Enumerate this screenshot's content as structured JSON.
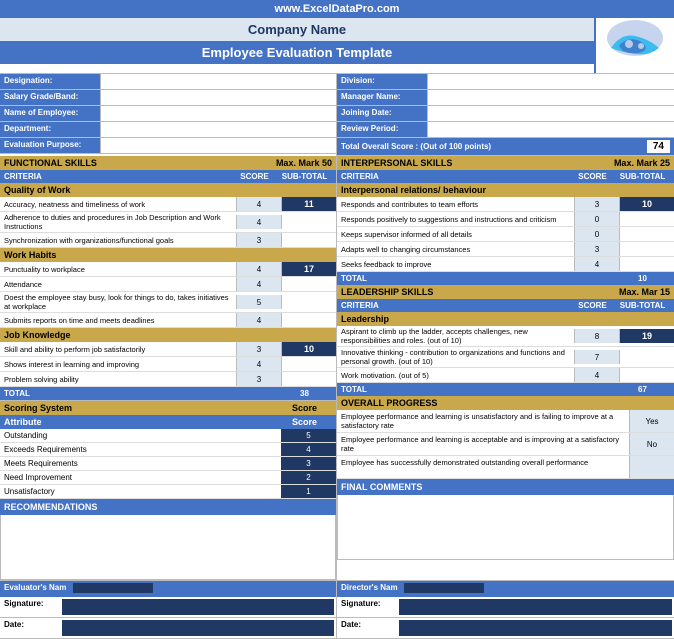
{
  "site": {
    "url": "www.ExcelDataPro.com",
    "company": "Company Name",
    "title": "Employee Evaluation Template"
  },
  "header": {
    "left": [
      {
        "label": "Designation:",
        "value": ""
      },
      {
        "label": "Salary Grade/Band:",
        "value": ""
      },
      {
        "label": "Name of Employee:",
        "value": ""
      },
      {
        "label": "Department:",
        "value": ""
      },
      {
        "label": "Evaluation Purpose:",
        "value": ""
      }
    ],
    "right": [
      {
        "label": "Division:",
        "value": ""
      },
      {
        "label": "Manager Name:",
        "value": ""
      },
      {
        "label": "Joining Date:",
        "value": ""
      },
      {
        "label": "Review Period:",
        "value": ""
      },
      {
        "label": "Total Overall Score : (Out of 100 points)",
        "value": "74"
      }
    ]
  },
  "functional_skills": {
    "title": "FUNCTIONAL SKILLS",
    "max_label": "Max. Mark",
    "max_value": "50",
    "criteria_label": "CRITERIA",
    "score_label": "SCORE",
    "subtotal_label": "SUB-TOTAL",
    "total_label": "TOTAL",
    "total_value": "38",
    "sections": [
      {
        "name": "Quality of Work",
        "subtotal": "11",
        "items": [
          {
            "text": "Accuracy, neatness and timeliness of work",
            "score": "4",
            "subtotal": ""
          },
          {
            "text": "Adherence to duties and procedures in Job Description and Work Instructions",
            "score": "4",
            "subtotal": ""
          },
          {
            "text": "Synchronization with organizations/functional goals",
            "score": "3",
            "subtotal": ""
          }
        ]
      },
      {
        "name": "Work Habits",
        "subtotal": "17",
        "items": [
          {
            "text": "Punctuality to workplace",
            "score": "4",
            "subtotal": ""
          },
          {
            "text": "Attendance",
            "score": "4",
            "subtotal": ""
          },
          {
            "text": "Doest the employee stay busy, look for things to do, takes initiatives at workplace",
            "score": "5",
            "subtotal": ""
          },
          {
            "text": "Submits reports on time and meets deadlines",
            "score": "4",
            "subtotal": ""
          }
        ]
      },
      {
        "name": "Job Knowledge",
        "subtotal": "10",
        "items": [
          {
            "text": "Skill and ability to perform job satisfactorily",
            "score": "3",
            "subtotal": ""
          },
          {
            "text": "Shows interest in learning and improving",
            "score": "4",
            "subtotal": ""
          },
          {
            "text": "Problem solving ability",
            "score": "3",
            "subtotal": ""
          }
        ]
      }
    ]
  },
  "scoring_system": {
    "title": "Scoring System",
    "attr_label": "Attribute",
    "score_label": "Score",
    "items": [
      {
        "label": "Outstanding",
        "value": "5"
      },
      {
        "label": "Exceeds Requirements",
        "value": "4"
      },
      {
        "label": "Meets Requirements",
        "value": "3"
      },
      {
        "label": "Need Improvement",
        "value": "2"
      },
      {
        "label": "Unsatisfactory",
        "value": "1"
      }
    ]
  },
  "recommendations": {
    "title": "RECOMMENDATIONS"
  },
  "interpersonal_skills": {
    "title": "INTERPERSONAL SKILLS",
    "max_label": "Max. Mark",
    "max_value": "25",
    "criteria_label": "CRITERIA",
    "score_label": "SCORE",
    "subtotal_label": "SUB-TOTAL",
    "sections": [
      {
        "name": "Interpersonal relations/ behaviour",
        "subtotal": "10",
        "items": [
          {
            "text": "Responds and contributes to team efforts",
            "score": "3",
            "subtotal": ""
          },
          {
            "text": "Responds positively to suggestions and instructions and criticism",
            "score": "0",
            "subtotal": ""
          },
          {
            "text": "Keeps supervisor informed of all details",
            "score": "0",
            "subtotal": ""
          },
          {
            "text": "Adapts well to changing circumstances",
            "score": "3",
            "subtotal": ""
          },
          {
            "text": "Seeks feedback to improve",
            "score": "4",
            "subtotal": ""
          }
        ]
      }
    ],
    "total_label": "TOTAL",
    "total_value": "10"
  },
  "leadership_skills": {
    "title": "LEADERSHIP SKILLS",
    "max_label": "Max. Mar",
    "max_value": "15",
    "criteria_label": "CRITERIA",
    "score_label": "SCORE",
    "subtotal_label": "SUB-TOTAL",
    "sections": [
      {
        "name": "Leadership",
        "subtotal": "19",
        "items": [
          {
            "text": "Aspirant to climb up the ladder, accepts challenges, new responsibilities and roles. (out of 10)",
            "score": "8",
            "subtotal": ""
          },
          {
            "text": "Innovative thinking - contribution to organizations and functions and personal growth. (out of 10)",
            "score": "7",
            "subtotal": ""
          },
          {
            "text": "Work motivation. (out of 5)",
            "score": "4",
            "subtotal": ""
          }
        ]
      }
    ],
    "total_label": "TOTAL",
    "total_value": "67"
  },
  "overall_progress": {
    "title": "OVERALL PROGRESS",
    "items": [
      {
        "text": "Employee performance and learning is unsatisfactory and is failing to improve at a satisfactory rate",
        "value": "Yes"
      },
      {
        "text": "Employee performance and learning is acceptable and is improving at a satisfactory rate",
        "value": "No"
      },
      {
        "text": "Employee has successfully demonstrated outstanding overall performance",
        "value": ""
      }
    ]
  },
  "final_comments": {
    "title": "FINAL COMMENTS"
  },
  "footer": {
    "left": {
      "name_label": "Evaluator's Nam",
      "sig_label": "Signature:",
      "date_label": "Date:"
    },
    "right": {
      "name_label": "Director's Nam",
      "sig_label": "Signature:",
      "date_label": "Date:"
    }
  }
}
